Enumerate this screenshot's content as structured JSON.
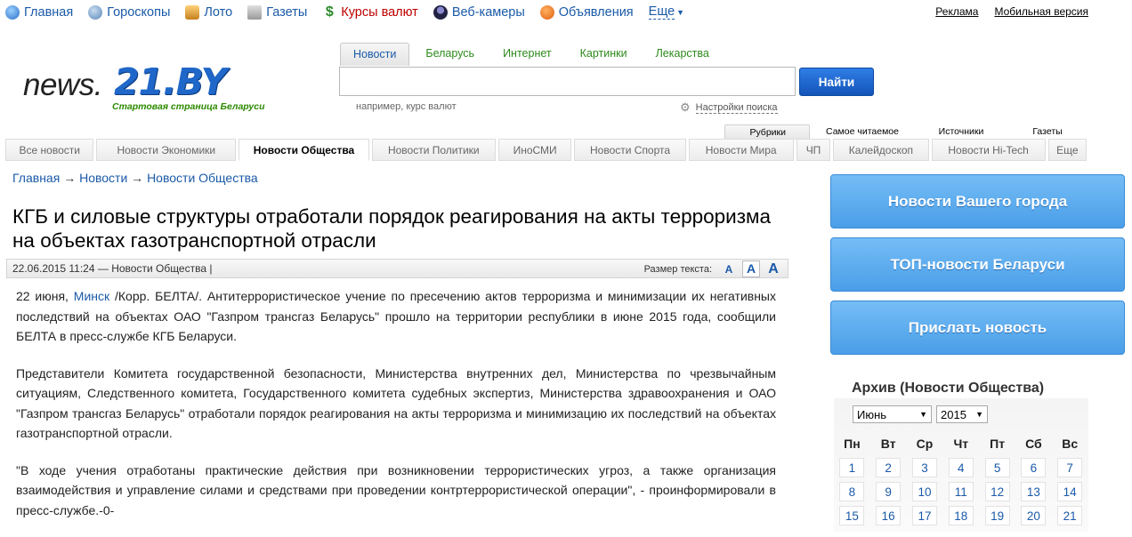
{
  "topnav": {
    "items": [
      {
        "label": "Главная",
        "icon": "globe-icon",
        "color": "#3a78c8"
      },
      {
        "label": "Гороскопы",
        "icon": "horoscope-icon",
        "color": "#6a8fbf"
      },
      {
        "label": "Лото",
        "icon": "lotto-icon",
        "color": "#d08a2a"
      },
      {
        "label": "Газеты",
        "icon": "newspaper-icon",
        "color": "#888888"
      },
      {
        "label": "Курсы валют",
        "icon": "dollar-icon",
        "color": "#2a8a2a"
      },
      {
        "label": "Веб-камеры",
        "icon": "webcam-icon",
        "color": "#333366"
      },
      {
        "label": "Объявления",
        "icon": "ads-icon",
        "color": "#e07020"
      }
    ],
    "more": "Еще"
  },
  "toplinks": {
    "ads": "Реклама",
    "mobile": "Мобильная версия"
  },
  "logo": {
    "news": "news.",
    "brand": "21.BY",
    "tagline": "Стартовая страница Беларуси"
  },
  "search": {
    "tabs": [
      "Новости",
      "Беларусь",
      "Интернет",
      "Картинки",
      "Лекарства"
    ],
    "active_tab": "Новости",
    "value": "",
    "button": "Найти",
    "hint": "например, курс валют",
    "settings": "Настройки поиска"
  },
  "rtabs": [
    "Рубрики",
    "Самое читаемое",
    "Источники",
    "Газеты"
  ],
  "categories": [
    {
      "label": "Все новости",
      "active": false
    },
    {
      "label": "Новости Экономики",
      "active": false
    },
    {
      "label": "Новости Общества",
      "active": true
    },
    {
      "label": "Новости Политики",
      "active": false
    },
    {
      "label": "ИноСМИ",
      "active": false
    },
    {
      "label": "Новости Спорта",
      "active": false
    },
    {
      "label": "Новости Мира",
      "active": false
    },
    {
      "label": "ЧП",
      "active": false
    },
    {
      "label": "Калейдоскоп",
      "active": false
    },
    {
      "label": "Новости Hi-Tech",
      "active": false
    },
    {
      "label": "Еще",
      "active": false
    }
  ],
  "breadcrumb": {
    "home": "Главная",
    "news": "Новости",
    "section": "Новости Общества",
    "sep": "→"
  },
  "article": {
    "headline": "КГБ и силовые структуры отработали порядок реагирования на акты терроризма на объектах газотранспортной отрасли",
    "meta": "22.06.2015 11:24 — Новости Общества |",
    "text_size_label": "Размер текста:",
    "sizes": [
      "A",
      "A",
      "A"
    ],
    "p1_pre": "22 июня, ",
    "p1_link": "Минск",
    "p1_post": " /Корр. БЕЛТА/. Антитеррористическое учение по пресечению актов терроризма и минимизации их негативных последствий на объектах ОАО \"Газпром трансгаз Беларусь\" прошло на территории республики в июне 2015 года, сообщили БЕЛТА в пресс-службе КГБ Беларуси.",
    "p2": "Представители Комитета государственной безопасности, Министерства внутренних дел, Министерства по чрезвычайным ситуациям, Следственного комитета, Государственного комитета судебных экспертиз, Министерства здравоохранения и ОАО \"Газпром трансгаз Беларусь\" отработали порядок реагирования на акты терроризма и минимизацию их последствий на объектах газотранспортной отрасли.",
    "p3": "\"В ходе учения отработаны практические действия при возникновении террористических угроз, а также организация взаимодействия и управление силами и средствами при проведении контртеррористической операции\", - проинформировали в пресс-службе.-0-"
  },
  "sidebar": {
    "buttons": [
      "Новости Вашего города",
      "ТОП-новости Беларуси",
      "Прислать новость"
    ],
    "archive_title": "Архив (Новости Общества)",
    "month": "Июнь",
    "year": "2015",
    "weekdays": [
      "Пн",
      "Вт",
      "Ср",
      "Чт",
      "Пт",
      "Сб",
      "Вс"
    ],
    "weeks": [
      [
        "1",
        "2",
        "3",
        "4",
        "5",
        "6",
        "7"
      ],
      [
        "8",
        "9",
        "10",
        "11",
        "12",
        "13",
        "14"
      ],
      [
        "15",
        "16",
        "17",
        "18",
        "19",
        "20",
        "21"
      ]
    ]
  }
}
